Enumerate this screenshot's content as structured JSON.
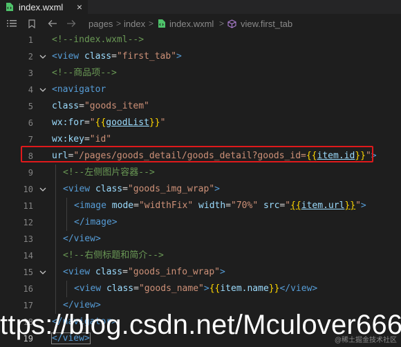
{
  "tab": {
    "label": "index.wxml",
    "close": "×",
    "icon": "wxml-file-icon"
  },
  "breadcrumb": {
    "items": [
      "pages",
      "index",
      "index.wxml",
      "view.first_tab"
    ],
    "separator": ">"
  },
  "lines": [
    {
      "n": "1"
    },
    {
      "n": "2"
    },
    {
      "n": "3"
    },
    {
      "n": "4"
    },
    {
      "n": "5"
    },
    {
      "n": "6"
    },
    {
      "n": "7"
    },
    {
      "n": "8"
    },
    {
      "n": "9"
    },
    {
      "n": "10"
    },
    {
      "n": "11"
    },
    {
      "n": "12"
    },
    {
      "n": "13"
    },
    {
      "n": "14"
    },
    {
      "n": "15"
    },
    {
      "n": "16"
    },
    {
      "n": "17"
    },
    {
      "n": "18"
    },
    {
      "n": "19"
    }
  ],
  "code": {
    "l1": [
      "<!--index.wxml-->"
    ],
    "l2": [
      "<view",
      " class",
      "=",
      "\"first_tab\"",
      ">"
    ],
    "l3": [
      "<!--商品项-->"
    ],
    "l4": [
      "<navigator"
    ],
    "l5": [
      "class",
      "=",
      "\"goods_item\""
    ],
    "l6": [
      "wx:for",
      "=",
      "\"",
      "{{",
      "goodList",
      "}}",
      "\""
    ],
    "l7": [
      "wx:key",
      "=",
      "\"id\""
    ],
    "l8": [
      "url",
      "=",
      "\"/pages/goods_detail/goods_detail?goods_id=",
      "{{",
      "item.id",
      "}}",
      "\"",
      ">"
    ],
    "l9": [
      "<!--左侧图片容器-->"
    ],
    "l10": [
      "<view",
      " class",
      "=",
      "\"goods_img_wrap\"",
      ">"
    ],
    "l11": [
      "<image",
      " mode",
      "=",
      "\"widthFix\"",
      " width",
      "=",
      "\"70%\"",
      " src",
      "=",
      "\"",
      "{{",
      "item.url",
      "}}",
      "\"",
      ">"
    ],
    "l12": [
      "</image>"
    ],
    "l13": [
      "</view>"
    ],
    "l14": [
      "<!--右侧标题和简介-->"
    ],
    "l15": [
      "<view",
      " class",
      "=",
      "\"goods_info_wrap\"",
      ">"
    ],
    "l16": [
      "<view",
      " class",
      "=",
      "\"goods_name\"",
      ">",
      "{{",
      "item.name",
      "}}",
      "</view>"
    ],
    "l17": [
      "</view>"
    ],
    "l18": [
      "</navigator>"
    ],
    "l19": [
      "</view>"
    ]
  },
  "watermark": {
    "main": "ttps://blog.csdn.net/Mculover666",
    "small": "@稀土掘金技术社区"
  },
  "colors": {
    "highlight_box": "#e0191b"
  }
}
